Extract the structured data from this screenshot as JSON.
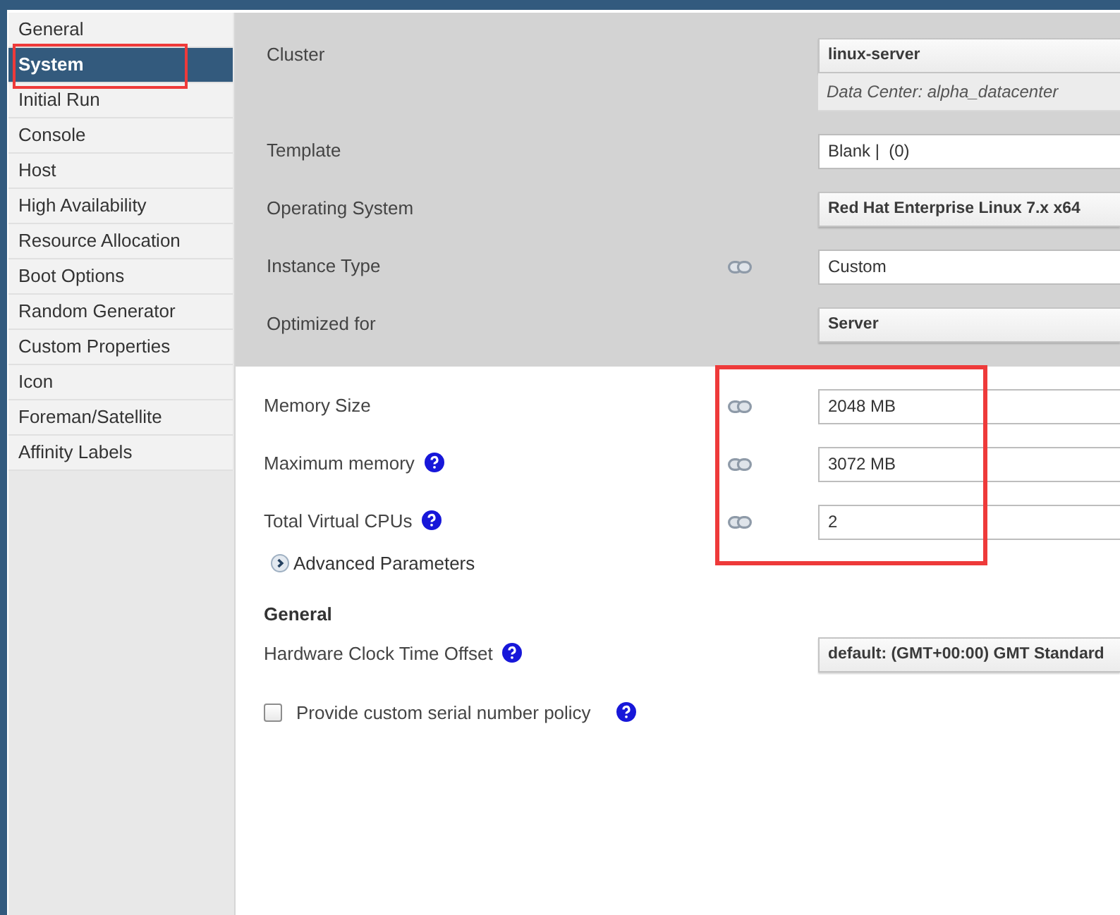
{
  "sidebar": {
    "items": [
      {
        "label": "General",
        "selected": false,
        "highlighted": false
      },
      {
        "label": "System",
        "selected": true,
        "highlighted": true
      },
      {
        "label": "Initial Run",
        "selected": false,
        "highlighted": false
      },
      {
        "label": "Console",
        "selected": false,
        "highlighted": false
      },
      {
        "label": "Host",
        "selected": false,
        "highlighted": false
      },
      {
        "label": "High Availability",
        "selected": false,
        "highlighted": false
      },
      {
        "label": "Resource Allocation",
        "selected": false,
        "highlighted": false
      },
      {
        "label": "Boot Options",
        "selected": false,
        "highlighted": false
      },
      {
        "label": "Random Generator",
        "selected": false,
        "highlighted": false
      },
      {
        "label": "Custom Properties",
        "selected": false,
        "highlighted": false
      },
      {
        "label": "Icon",
        "selected": false,
        "highlighted": false
      },
      {
        "label": "Foreman/Satellite",
        "selected": false,
        "highlighted": false
      },
      {
        "label": "Affinity Labels",
        "selected": false,
        "highlighted": false
      }
    ]
  },
  "system_settings": {
    "fields": [
      {
        "label": "Cluster",
        "help": false,
        "linked": false,
        "kind": "select",
        "value": "linux-server",
        "note": "Data Center: alpha_datacenter"
      },
      {
        "label": "Template",
        "help": false,
        "linked": false,
        "kind": "input",
        "value": "Blank |  (0)"
      },
      {
        "label": "Operating System",
        "help": false,
        "linked": false,
        "kind": "select",
        "value": "Red Hat Enterprise Linux 7.x x64"
      },
      {
        "label": "Instance Type",
        "help": false,
        "linked": true,
        "kind": "input",
        "value": "Custom"
      },
      {
        "label": "Optimized for",
        "help": false,
        "linked": false,
        "kind": "select",
        "value": "Server"
      }
    ]
  },
  "resources": {
    "highlighted": true,
    "fields": [
      {
        "label": "Memory Size",
        "help": false,
        "linked": true,
        "kind": "input",
        "value": "2048 MB"
      },
      {
        "label": "Maximum memory",
        "help": true,
        "linked": true,
        "kind": "input",
        "value": "3072 MB"
      },
      {
        "label": "Total Virtual CPUs",
        "help": true,
        "linked": true,
        "kind": "input",
        "value": "2"
      }
    ]
  },
  "advanced_parameters": {
    "label": "Advanced Parameters",
    "expanded": false
  },
  "general": {
    "heading": "General",
    "fields": [
      {
        "label": "Hardware Clock Time Offset",
        "help": true,
        "linked": false,
        "kind": "select",
        "value": "default: (GMT+00:00) GMT Standard"
      }
    ],
    "serial_policy": {
      "label": "Provide custom serial number policy",
      "checked": false,
      "help": true
    }
  }
}
